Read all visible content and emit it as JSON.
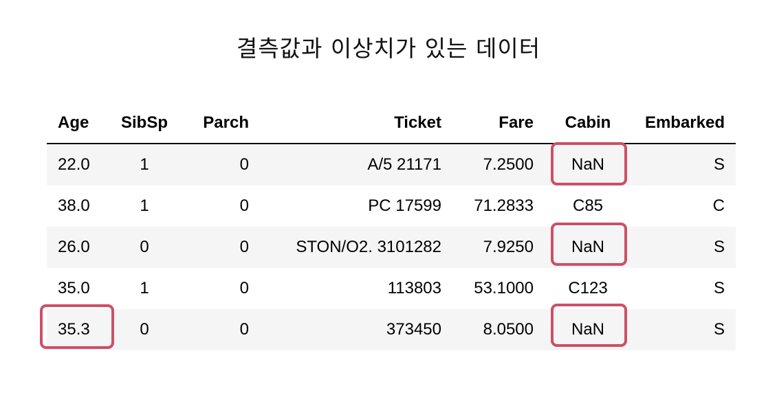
{
  "title": "결측값과 이상치가 있는 데이터",
  "table": {
    "columns": [
      "Age",
      "SibSp",
      "Parch",
      "Ticket",
      "Fare",
      "Cabin",
      "Embarked"
    ],
    "rows": [
      [
        "22.0",
        "1",
        "0",
        "A/5 21171",
        "7.2500",
        "NaN",
        "S"
      ],
      [
        "38.0",
        "1",
        "0",
        "PC 17599",
        "71.2833",
        "C85",
        "C"
      ],
      [
        "26.0",
        "0",
        "0",
        "STON/O2. 3101282",
        "7.9250",
        "NaN",
        "S"
      ],
      [
        "35.0",
        "1",
        "0",
        "113803",
        "53.1000",
        "C123",
        "S"
      ],
      [
        "35.3",
        "0",
        "0",
        "373450",
        "8.0500",
        "NaN",
        "S"
      ]
    ]
  },
  "colors": {
    "highlight_border": "#cc5068",
    "stripe_background": "#f5f5f5"
  }
}
